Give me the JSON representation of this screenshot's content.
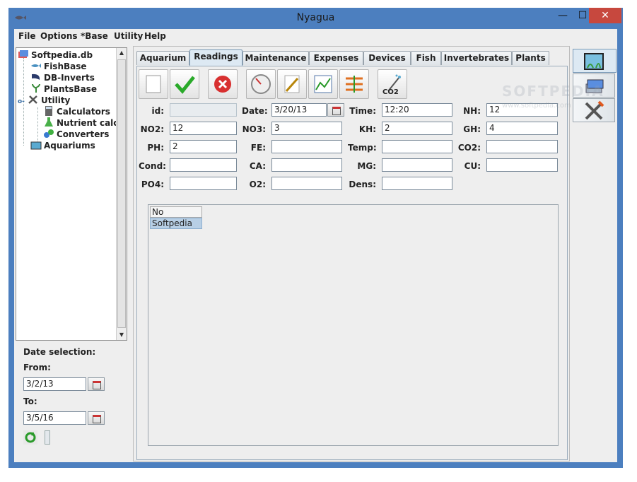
{
  "window": {
    "title": "Nyagua",
    "minimize": "—",
    "maximize": "☐",
    "close": "✕"
  },
  "menu": [
    "File",
    "Options",
    "*Base",
    "Utility",
    "Help"
  ],
  "tree": {
    "root": "Softpedia.db",
    "items": [
      "FishBase",
      "DB-Inverts",
      "PlantsBase",
      "Utility",
      "Calculators",
      "Nutrient calcul",
      "Converters",
      "Aquariums"
    ]
  },
  "date_selection": {
    "title": "Date selection:",
    "from_label": "From:",
    "from_value": "3/2/13",
    "to_label": "To:",
    "to_value": "3/5/16"
  },
  "tabs": [
    "Aquarium",
    "Readings",
    "Maintenance",
    "Expenses",
    "Devices",
    "Fish",
    "Invertebrates",
    "Plants"
  ],
  "active_tab": "Readings",
  "toolbar": [
    "new-icon",
    "save-check-icon",
    "delete-icon",
    "gauge-icon",
    "edit-icon",
    "chart-icon",
    "settings-bars-icon",
    "co2-icon"
  ],
  "form": {
    "id": {
      "label": "id:",
      "value": ""
    },
    "date": {
      "label": "Date:",
      "value": "3/20/13"
    },
    "time": {
      "label": "Time:",
      "value": "12:20"
    },
    "nh": {
      "label": "NH:",
      "value": "12"
    },
    "no2": {
      "label": "NO2:",
      "value": "12"
    },
    "no3": {
      "label": "NO3:",
      "value": "3"
    },
    "kh": {
      "label": "KH:",
      "value": "2"
    },
    "gh": {
      "label": "GH:",
      "value": "4"
    },
    "ph": {
      "label": "PH:",
      "value": "2"
    },
    "fe": {
      "label": "FE:",
      "value": ""
    },
    "temp": {
      "label": "Temp:",
      "value": ""
    },
    "co2": {
      "label": "CO2:",
      "value": ""
    },
    "cond": {
      "label": "Cond:",
      "value": ""
    },
    "ca": {
      "label": "CA:",
      "value": ""
    },
    "mg": {
      "label": "MG:",
      "value": ""
    },
    "cu": {
      "label": "CU:",
      "value": ""
    },
    "po4": {
      "label": "PO4:",
      "value": ""
    },
    "o2": {
      "label": "O2:",
      "value": ""
    },
    "dens": {
      "label": "Dens:",
      "value": ""
    }
  },
  "list": {
    "header": "No selection",
    "rows": [
      "Softpedia"
    ]
  },
  "watermark": {
    "text": "SOFTPEDIA",
    "url": "www.softpedia.com"
  },
  "colors": {
    "titlebar": "#4c7fbf",
    "close": "#c7483e",
    "selection": "#b8cfe5"
  }
}
